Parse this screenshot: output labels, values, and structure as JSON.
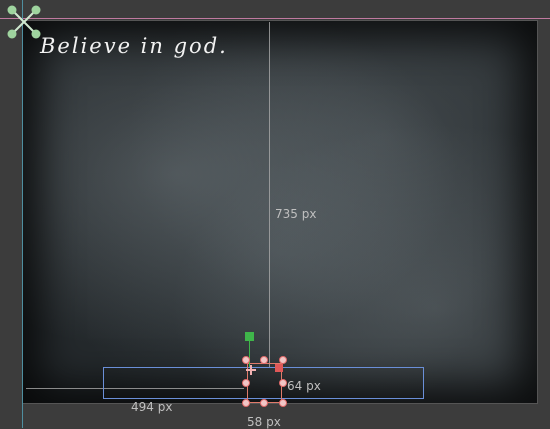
{
  "canvas": {
    "text": "Believe in god.",
    "icon": "anchor-cross-icon"
  },
  "measurements": {
    "vertical": "735 px",
    "horizontal": "494 px",
    "height": "64 px",
    "width": "58 px"
  },
  "colors": {
    "selection": "#6a8fd8",
    "inner": "#e07a6a",
    "anchor_green": "#3fb54a",
    "handle": "#f1c6c6",
    "guide": "#c07aa0"
  }
}
